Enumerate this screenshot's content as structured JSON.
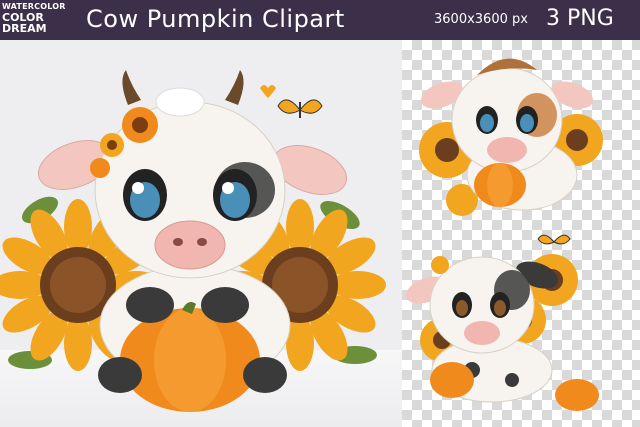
{
  "header": {
    "logo_line1": "WATERCOLOR",
    "logo_line2": "COLOR",
    "logo_line3": "DREAM",
    "title": "Cow  Pumpkin  Clipart",
    "size": "3600x3600  px",
    "count": "3 PNG"
  },
  "colors": {
    "header_bg": "#3b2f4a",
    "sunflower": "#f2a51f",
    "pumpkin": "#f08a1c",
    "cow_white": "#f7f3ee",
    "cow_spot": "#3a3a3a",
    "checker": "#d9d9d9"
  },
  "artworks": [
    {
      "name": "Large cow with pumpkin and sunflowers"
    },
    {
      "name": "Brown-tufted cow with sunflowers and pumpkin"
    },
    {
      "name": "Spotted cow with pumpkins and sunflowers"
    }
  ]
}
